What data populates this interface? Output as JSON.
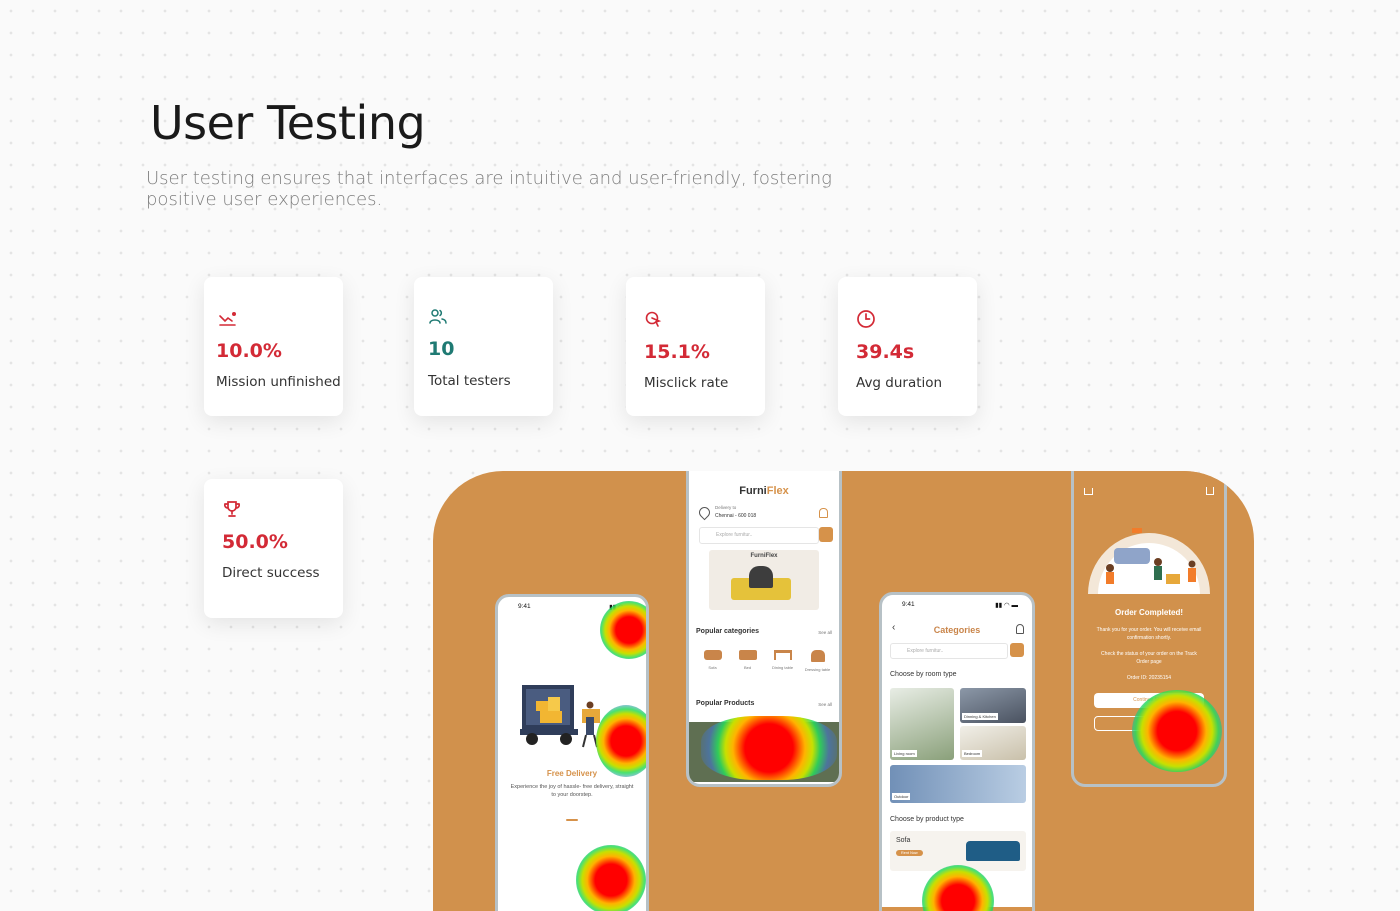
{
  "header": {
    "title": "User Testing",
    "subtitle": "User testing ensures that interfaces are intuitive and user-friendly, fostering positive user experiences."
  },
  "stats": [
    {
      "icon": "trend-down-icon",
      "value": "10.0%",
      "label": "Mission unfinished",
      "color": "#d32a36"
    },
    {
      "icon": "users-icon",
      "value": "10",
      "label": "Total testers",
      "color": "#1f7a73"
    },
    {
      "icon": "cursor-click-icon",
      "value": "15.1%",
      "label": "Misclick rate",
      "color": "#d32a36"
    },
    {
      "icon": "clock-icon",
      "value": "39.4s",
      "label": "Avg duration",
      "color": "#d32a36"
    },
    {
      "icon": "trophy-icon",
      "value": "50.0%",
      "label": "Direct success",
      "color": "#d32a36"
    }
  ],
  "colors": {
    "stage": "#d1914c",
    "accent_red": "#d32a36",
    "accent_teal": "#1f7a73",
    "brand_orange": "#d6924a"
  },
  "screens": {
    "onboarding": {
      "time": "9:41",
      "title": "Free Delivery",
      "body": "Experience the joy of hassle- free delivery, straight to your doorstep."
    },
    "home": {
      "brand_prefix": "Furni",
      "brand_suffix": "Flex",
      "delivery_label": "Delivery to",
      "delivery_address": "Chennai - 600 018",
      "search_placeholder": "Explore furnitur..",
      "banner_brand": "FurniFlex",
      "popular_categories": "Popular categories",
      "see_all": "See all",
      "categories": [
        "Sofa",
        "Bed",
        "Dining table",
        "Dressing table"
      ],
      "popular_products": "Popular Products",
      "see_all_products": "See all"
    },
    "categories": {
      "time": "9:41",
      "title": "Categories",
      "search_placeholder": "Explore furnitur..",
      "room_heading": "Choose by room type",
      "rooms": [
        "Living room",
        "Dinning & Kitchen",
        "Bedroom",
        "Outdoor"
      ],
      "product_heading": "Choose by product type",
      "product_name": "Sofa",
      "product_button": "Rent Now"
    },
    "order": {
      "title": "Order Completed!",
      "message": "Thank you for your order. You will receive email confirmation shortly.",
      "track_text": "Check the status of your order on the Track Order page",
      "order_id": "Order ID: 20235154",
      "continue_label": "Continue Sh..."
    }
  }
}
